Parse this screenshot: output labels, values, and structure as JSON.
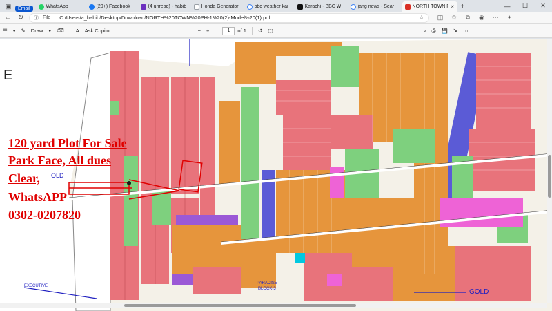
{
  "tabs": [
    {
      "label": "Email",
      "type": "chip",
      "color": "#0b57d0"
    },
    {
      "label": "WhatsApp",
      "fav": "#25d366"
    },
    {
      "label": "(20+) Facebook",
      "fav": "#1877f2"
    },
    {
      "label": "(4 unread) - habib",
      "fav": "#6b2fbf"
    },
    {
      "label": "Honda Generator",
      "fav": "#9aa0a6"
    },
    {
      "label": "bbc weather kar",
      "fav": "#4285f4"
    },
    {
      "label": "Karachi - BBC W",
      "fav": "#111111"
    },
    {
      "label": "jang news - Sear",
      "fav": "#4285f4"
    },
    {
      "label": "NORTH TOWN P",
      "fav": "#d93025",
      "active": true
    }
  ],
  "address": {
    "file_chip": "File",
    "url": "C:/Users/a_habib/Desktop/Download/NORTH%20TOWN%20PH-1%20(2)-Model%20(1).pdf"
  },
  "pdf_toolbar": {
    "draw_label": "Draw",
    "copilot_label": "Ask Copilot",
    "page_current": "1",
    "page_total": "of 1"
  },
  "document": {
    "edge_letter": "E",
    "ad_lines": [
      "120 yard Plot For Sale",
      "Park Face, All dues",
      "Clear,",
      "WhatsAPP",
      "0302-0207820"
    ],
    "labels": {
      "old": "OLD",
      "executive": "EXECUTIVE",
      "paradise1": "PARADISE",
      "paradise2": "BLOCK-3",
      "gold": "GOLD"
    }
  },
  "colors": {
    "plot_red": "#e8737b",
    "plot_orange": "#e6953c",
    "park_green": "#7ed07e",
    "road_blue": "#5b5bd6",
    "commercial_pink": "#ee63d6",
    "ad_red": "#e00000"
  }
}
